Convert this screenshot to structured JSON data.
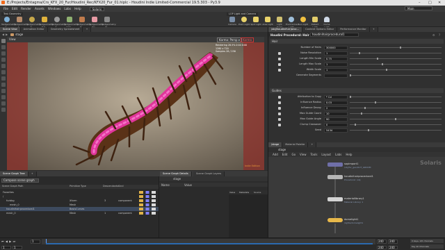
{
  "window": {
    "title": "E:/Projects/Entagma/Crs_KFX_20_Fur/Houdini_Rec/KFX20_Fur_01.hiplc - Houdini Indie Limited-Commercial 19.5.303 - Py3.9",
    "controls": [
      "–",
      "□",
      "✕"
    ]
  },
  "menu": {
    "items": [
      "File",
      "Edit",
      "Render",
      "Assets",
      "Windows",
      "Labs",
      "Help"
    ],
    "desktop": "Solaris",
    "context": "Main"
  },
  "shelf": {
    "tab": "Test Geometry",
    "lights_tab": "LOP Light and Camera",
    "tools": [
      "Testgeometry: C...",
      "Testgeometry: A...",
      "Testgeometry: T...",
      "Testgeometry: Rub...",
      "Testgeometry: S...",
      "Testgeometry: Sqrt...",
      "Testgeometry: Te...",
      "Testgeometry: Pig...",
      "Testgeometry: W..."
    ],
    "light_tools": [
      "Camera",
      "Point Light",
      "Spot Light",
      "Area Light",
      "Light Portal",
      "Environment Light",
      "Sun Light",
      "Distant Light",
      "Dome Light"
    ],
    "main_label": "Main"
  },
  "panes": {
    "left_tabs": [
      "Scene View",
      "Animation Editor",
      "Geometry Spreadsheet",
      "+"
    ],
    "right_tabs": [
      "/obj/houdinifurr/proc...",
      "Content Options Editor",
      "Performance Monitor",
      "+"
    ],
    "stage_path": "stage",
    "view_label": "View"
  },
  "viewport": {
    "camera": "Karma: Persp ▾",
    "renderer": "Karma",
    "stats": [
      "Rendering  28.5%  0:04   0:00",
      "1280 x 720",
      "Samples  28 / 256"
    ],
    "badge": "Indie Edition"
  },
  "parms": {
    "node_type": "Houdini Procedural: Hair",
    "node_name": "houdinihairprocedural1",
    "sections": [
      "Hair",
      "Guides"
    ],
    "hair": [
      {
        "label": "Number of Hairs",
        "value": "300000",
        "fill": 0.55,
        "check": false
      },
      {
        "label": "Noise Resolution",
        "value": "1",
        "fill": 0.1,
        "check": true
      },
      {
        "label": "Length Min Scale",
        "value": "0.75",
        "fill": 0.3,
        "check": true
      },
      {
        "label": "Length Max Scale",
        "value": "1",
        "fill": 0.35,
        "check": true
      },
      {
        "label": "Width Scale",
        "value": "1",
        "fill": 0.4,
        "check": true
      },
      {
        "label": "Generate Segments",
        "value": "",
        "fill": 0,
        "check": false
      }
    ],
    "guides": [
      {
        "label": "Attribution to Copy",
        "value": "* Cd",
        "fill": 0,
        "check": true
      },
      {
        "label": "Influence Radius",
        "value": "0.03",
        "fill": 0.28,
        "check": true
      },
      {
        "label": "Influence Decay",
        "value": "2",
        "fill": 0.16,
        "check": true
      },
      {
        "label": "Max Guide Count",
        "value": "10",
        "fill": 0.12,
        "check": true
      },
      {
        "label": "Max Guide Angle",
        "value": "90",
        "fill": 0.5,
        "check": true
      },
      {
        "label": "Clump Crossover",
        "value": "0",
        "fill": 0.05,
        "check": true
      },
      {
        "label": "Seed",
        "value": "5434",
        "fill": 0.2,
        "check": false
      }
    ]
  },
  "network": {
    "tabs": [
      "/stage",
      "Material Palette",
      "+"
    ],
    "path": "stage",
    "menu": [
      "Add",
      "Edit",
      "Go",
      "View",
      "Tools",
      "Layout",
      "Labs",
      "Help"
    ],
    "watermark": "Solaris",
    "nodes": [
      {
        "name": "sopimport1",
        "desc": "/obj/fur_geo/OUT_GROOM",
        "color": "#6f6fa8"
      },
      {
        "name": "houdinihairprocedural1",
        "desc": "Procedural: /obj",
        "color": "#b5b5b5"
      },
      {
        "name": "materiallibrary1",
        "desc": "Material Library: 1",
        "color": "#d4d4d4"
      },
      {
        "name": "domelight1",
        "desc": "/lights/domelight1",
        "color": "#e8b84a"
      }
    ]
  },
  "scene_tree": {
    "tabs": [
      "Scene Graph Tree",
      "+"
    ],
    "props_tabs": [
      "Scene Graph Details",
      "Scene Graph Layers"
    ],
    "button": "Compose scene graph",
    "columns": [
      "Scene Graph Path",
      "Primitive Type",
      "Descendants",
      "Kind"
    ],
    "rows": [
      {
        "path": "Favorites",
        "type": "",
        "desc": "",
        "kind": "",
        "indent": 0
      },
      {
        "path": "/",
        "type": "",
        "desc": "",
        "kind": "",
        "indent": 0
      },
      {
        "path": "furbbg",
        "type": "Xform",
        "desc": "3",
        "kind": "component",
        "indent": 1
      },
      {
        "path": "mesh_0",
        "type": "Mesh",
        "desc": "",
        "kind": "",
        "indent": 2
      },
      {
        "path": "houdinihairprocedural1",
        "type": "BasisCurves",
        "desc": "",
        "kind": "",
        "indent": 1
      },
      {
        "path": "mesh_0",
        "type": "Mesh",
        "desc": "1",
        "kind": "component",
        "indent": 1
      }
    ],
    "props_columns": [
      "Name",
      "Value"
    ],
    "props_sub": [
      "Value",
      "Metadata",
      "Source"
    ]
  },
  "timeline": {
    "start": "1",
    "end": "240",
    "current": "1",
    "frame_field": "240",
    "frame_field2": "240",
    "keys_label": "0 keys, 0/0 channels",
    "key_all": "Key All Channels",
    "auto_update": "Auto Update"
  }
}
